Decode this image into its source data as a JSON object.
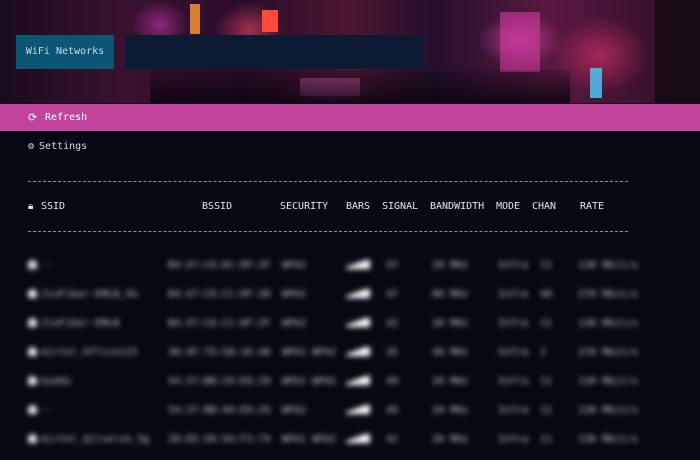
{
  "app": {
    "title": "WiFi Networks"
  },
  "search": {
    "value": "",
    "placeholder": ""
  },
  "toolbar": {
    "refresh_label": "Refresh",
    "refresh_icon": "refresh-icon",
    "settings_label": "Settings",
    "settings_icon": "gear-icon"
  },
  "table": {
    "ssid_icon": "wifi-icon",
    "columns": {
      "ssid": "SSID",
      "bssid": "BSSID",
      "security": "SECURITY",
      "bars": "BARS",
      "signal": "SIGNAL",
      "bandwidth": "BANDWIDTH",
      "mode": "MODE",
      "chan": "CHAN",
      "rate": "RATE"
    },
    "rows": [
      {
        "ssid": "--",
        "bssid": "B4:47:C6:DC:0F:2F",
        "security": "WPA2",
        "signal": "47",
        "bandwidth": "20 MHz",
        "mode": "Infra",
        "chan": "11",
        "rate": "130 Mbit/s"
      },
      {
        "ssid": "JioFiber-EMLN_5G",
        "bssid": "B4:47:C6:CC:0F:30",
        "security": "WPA2",
        "signal": "47",
        "bandwidth": "80 MHz",
        "mode": "Infra",
        "chan": "48",
        "rate": "270 Mbit/s"
      },
      {
        "ssid": "JioFiber-EMLN",
        "bssid": "B4:47:C6:CC:0F:2F",
        "security": "WPA2",
        "signal": "42",
        "bandwidth": "20 MHz",
        "mode": "Infra",
        "chan": "11",
        "rate": "130 Mbit/s"
      },
      {
        "ssid": "Airtel_Office123",
        "bssid": "30:4F:75:58:1E:48",
        "security": "WPA1 WPA2",
        "signal": "35",
        "bandwidth": "40 MHz",
        "mode": "Infra",
        "chan": "2",
        "rate": "270 Mbit/s"
      },
      {
        "ssid": "Guddu",
        "bssid": "54:37:BB:29:E9:29",
        "security": "WPA1 WPA2",
        "signal": "49",
        "bandwidth": "20 MHz",
        "mode": "Infra",
        "chan": "11",
        "rate": "130 Mbit/s"
      },
      {
        "ssid": "--",
        "bssid": "54:37:BB:49:E9:29",
        "security": "WPA2",
        "signal": "49",
        "bandwidth": "20 MHz",
        "mode": "Infra",
        "chan": "11",
        "rate": "130 Mbit/s"
      },
      {
        "ssid": "Airtel_Qilverze_5g",
        "bssid": "28:EE:56:5A:F3:79",
        "security": "WPA1 WPA2",
        "signal": "42",
        "bandwidth": "20 MHz",
        "mode": "Infra",
        "chan": "11",
        "rate": "130 Mbit/s"
      }
    ]
  },
  "colors": {
    "accent": "#c2449c",
    "title_bg": "#0b5575",
    "search_bg": "#0d1a33",
    "background": "#050913"
  }
}
